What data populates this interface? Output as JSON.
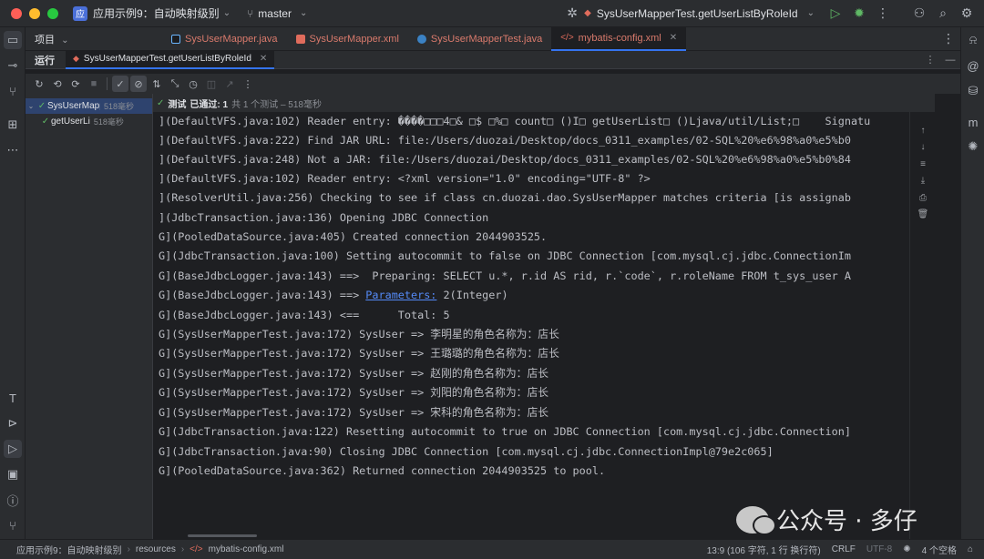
{
  "titlebar": {
    "project_badge": "应",
    "project_name": "应用示例9：自动映射级别",
    "branch": "master",
    "run_config": "SysUserMapperTest.getUserListByRoleId"
  },
  "tool_window": {
    "project_label": "项目"
  },
  "editor_tabs": [
    {
      "label": "SysUserMapper.java",
      "color": "#6bb6ff"
    },
    {
      "label": "SysUserMapper.xml",
      "color": "#e06c5c"
    },
    {
      "label": "SysUserMapperTest.java",
      "color": "#6bb6ff"
    },
    {
      "label": "mybatis-config.xml",
      "color": "#e06c5c"
    }
  ],
  "run": {
    "label": "运行",
    "tab_label": "SysUserMapperTest.getUserListByRoleId"
  },
  "tree": {
    "items": [
      {
        "name": "SysUserMapp",
        "time": "518毫秒"
      },
      {
        "name": "getUserLi",
        "time": "518毫秒"
      }
    ]
  },
  "summary": {
    "label": "测试",
    "passed": "已通过: 1",
    "detail": "共 1 个测试 – 518毫秒"
  },
  "console": {
    "lines": [
      "](DefaultVFS.java:102) Reader entry: ����□□□4□& □$ □%□ count□ ()I□ getUserList□ ()Ljava/util/List;□    Signatu",
      "](DefaultVFS.java:222) Find JAR URL: file:/Users/duozai/Desktop/docs_0311_examples/02-SQL%20%e6%98%a0%e5%b0",
      "](DefaultVFS.java:248) Not a JAR: file:/Users/duozai/Desktop/docs_0311_examples/02-SQL%20%e6%98%a0%e5%b0%84",
      "](DefaultVFS.java:102) Reader entry: <?xml version=\"1.0\" encoding=\"UTF-8\" ?>",
      "](ResolverUtil.java:256) Checking to see if class cn.duozai.dao.SysUserMapper matches criteria [is assignab",
      "](JdbcTransaction.java:136) Opening JDBC Connection",
      "G](PooledDataSource.java:405) Created connection 2044903525.",
      "G](JdbcTransaction.java:100) Setting autocommit to false on JDBC Connection [com.mysql.cj.jdbc.ConnectionIm",
      "G](BaseJdbcLogger.java:143) ==>  Preparing: SELECT u.*, r.id AS rid, r.`code`, r.roleName FROM t_sys_user A",
      "G](BaseJdbcLogger.java:143) <==      Total: 5",
      "G](SysUserMapperTest.java:172) SysUser => 李明星的角色名称为：店长",
      "G](SysUserMapperTest.java:172) SysUser => 王璐璐的角色名称为：店长",
      "G](SysUserMapperTest.java:172) SysUser => 赵刚的角色名称为：店长",
      "G](SysUserMapperTest.java:172) SysUser => 刘阳的角色名称为：店长",
      "G](SysUserMapperTest.java:172) SysUser => 宋科的角色名称为：店长",
      "G](JdbcTransaction.java:122) Resetting autocommit to true on JDBC Connection [com.mysql.cj.jdbc.Connection]",
      "G](JdbcTransaction.java:90) Closing JDBC Connection [com.mysql.cj.jdbc.ConnectionImpl@79e2c065]",
      "G](PooledDataSource.java:362) Returned connection 2044903525 to pool."
    ],
    "params_prefix": "G](BaseJdbcLogger.java:143) ==> ",
    "params_link": "Parameters:",
    "params_suffix": " 2(Integer)"
  },
  "watermark": "公众号 · 多仔",
  "statusbar": {
    "crumbs": [
      "应用示例9：自动映射级别",
      "resources",
      "mybatis-config.xml"
    ],
    "position": "13:9 (106 字符, 1 行 换行符)",
    "line_sep": "CRLF",
    "encoding": "UTF-8",
    "indent": "4 个空格"
  },
  "right_strip_label": "通知"
}
